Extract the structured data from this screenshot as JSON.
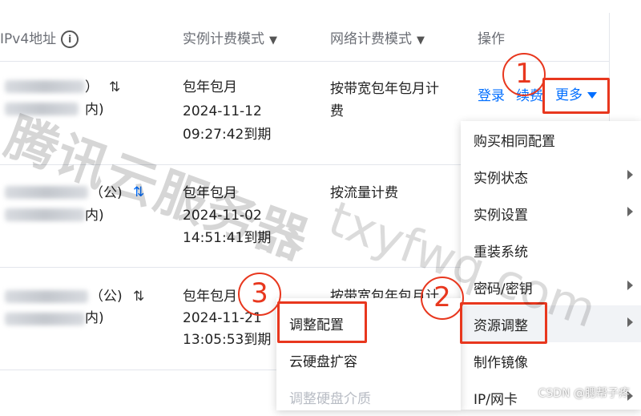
{
  "header": {
    "col_ip": "IPv4地址",
    "col_instance_billing": "实例计费模式",
    "col_network_billing": "网络计费模式",
    "col_actions": "操作"
  },
  "rows": [
    {
      "ip_suffix": "）",
      "ip_suffix2": "内)",
      "instance_billing": "包年包月",
      "expire_date": "2024-11-12",
      "expire_time": "09:27:42到期",
      "network_billing_line1": "按带宽包年包月计",
      "network_billing_line2": "费"
    },
    {
      "ip_suffix": "（公)",
      "ip_suffix2": "内)",
      "instance_billing": "包年包月",
      "expire_date": "2024-11-02",
      "expire_time": "14:51:41到期",
      "network_billing_line1": "按流量计费",
      "network_billing_line2": ""
    },
    {
      "ip_suffix": "（公)",
      "ip_suffix2": "内)",
      "instance_billing": "包年包月",
      "expire_date": "2024-11-21",
      "expire_time": "13:05:53到期",
      "network_billing_line1": "按带宽包年包月计",
      "network_billing_line2": ""
    }
  ],
  "actions": {
    "login": "登录",
    "renew": "续费",
    "more": "更多"
  },
  "main_menu": [
    {
      "label": "购买相同配置",
      "submenu": false
    },
    {
      "label": "实例状态",
      "submenu": true
    },
    {
      "label": "实例设置",
      "submenu": true
    },
    {
      "label": "重装系统",
      "submenu": false
    },
    {
      "label": "密码/密钥",
      "submenu": true
    },
    {
      "label": "资源调整",
      "submenu": true
    },
    {
      "label": "制作镜像",
      "submenu": false
    },
    {
      "label": "IP/网卡",
      "submenu": true
    }
  ],
  "sub_menu": [
    {
      "label": "调整配置",
      "disabled": false
    },
    {
      "label": "云硬盘扩容",
      "disabled": false
    },
    {
      "label": "调整硬盘介质",
      "disabled": true
    }
  ],
  "annotations": {
    "step1": "1",
    "step2": "2",
    "step3": "3",
    "color": "#e8371e"
  },
  "watermark": {
    "cn": "腾讯云服务器",
    "en": "txyfwq.com",
    "source": "CSDN @腮帮子疼"
  },
  "colors": {
    "link": "#006eff",
    "header_text": "#6b6e75",
    "border": "#e3e6ec"
  }
}
